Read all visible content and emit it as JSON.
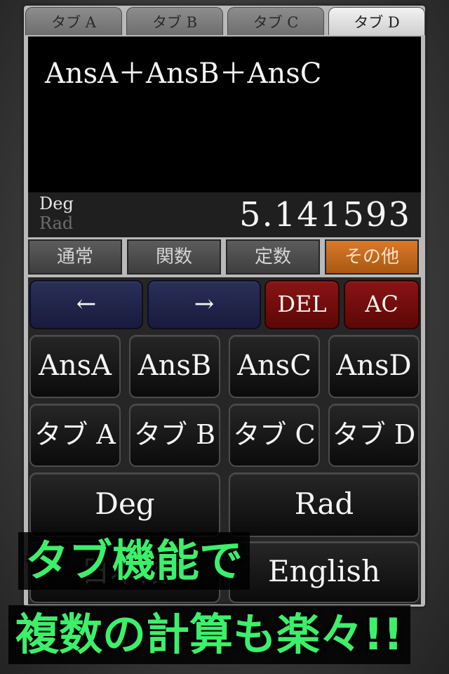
{
  "tabs": [
    {
      "label": "タブ A",
      "active": false
    },
    {
      "label": "タブ B",
      "active": false
    },
    {
      "label": "タブ C",
      "active": false
    },
    {
      "label": "タブ D",
      "active": true
    }
  ],
  "display": {
    "expression": "AnsA＋AnsB＋AnsC",
    "mode_deg": "Deg",
    "mode_rad": "Rad",
    "result": "5.141593"
  },
  "categories": [
    {
      "label": "通常",
      "active": false
    },
    {
      "label": "関数",
      "active": false
    },
    {
      "label": "定数",
      "active": false
    },
    {
      "label": "その他",
      "active": true
    }
  ],
  "keys": {
    "left": "←",
    "right": "→",
    "del": "DEL",
    "ac": "AC",
    "ans": [
      "AnsA",
      "AnsB",
      "AnsC",
      "AnsD"
    ],
    "tabs": [
      "タブ A",
      "タブ B",
      "タブ C",
      "タブ D"
    ],
    "deg": "Deg",
    "rad": "Rad",
    "japanese": "日本語",
    "english": "English"
  },
  "promo": {
    "line1": "タブ機能で",
    "line2": "複数の計算も楽々!!"
  },
  "colors": {
    "active_category": "#c56a1c",
    "nav_key": "#22264a",
    "red_key": "#7a0e0e",
    "promo_text": "#3cf06a"
  }
}
